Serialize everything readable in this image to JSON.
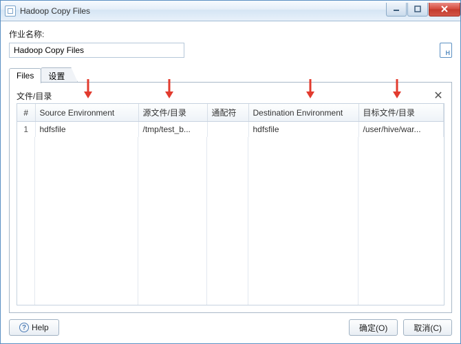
{
  "window": {
    "title": "Hadoop Copy Files"
  },
  "form": {
    "name_label": "作业名称:",
    "name_value": "Hadoop Copy Files"
  },
  "tabs": {
    "files": "Files",
    "settings": "设置"
  },
  "files_panel": {
    "section_title": "文件/目录",
    "close_symbol": "✕",
    "columns": {
      "num": "#",
      "source_env": "Source Environment",
      "source_path": "源文件/目录",
      "wildcard": "通配符",
      "dest_env": "Destination Environment",
      "dest_path": "目标文件/目录"
    },
    "rows": [
      {
        "num": "1",
        "source_env": "hdfsfile",
        "source_path": "/tmp/test_b...",
        "wildcard": "",
        "dest_env": "hdfsfile",
        "dest_path": "/user/hive/war..."
      }
    ]
  },
  "buttons": {
    "help": "Help",
    "ok": "确定(O)",
    "cancel": "取消(C)"
  },
  "colors": {
    "accent": "#5a8fc2",
    "arrow": "#e23b2e"
  }
}
